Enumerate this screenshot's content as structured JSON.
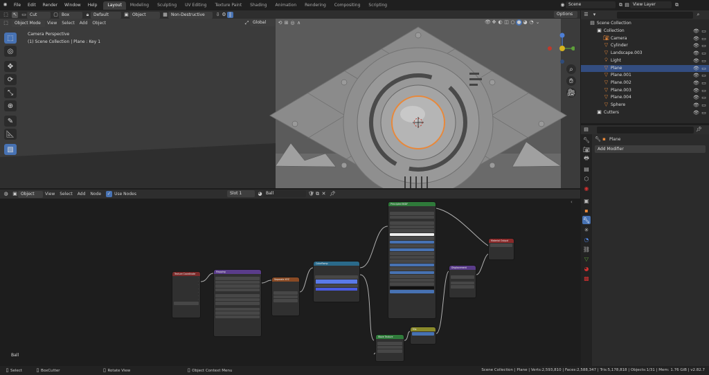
{
  "topbar": {
    "menus": [
      "File",
      "Edit",
      "Render",
      "Window",
      "Help"
    ],
    "workspaces": [
      "Layout",
      "Modeling",
      "Sculpting",
      "UV Editing",
      "Texture Paint",
      "Shading",
      "Animation",
      "Rendering",
      "Compositing",
      "Scripting"
    ],
    "active_workspace": "Layout",
    "scene": "Scene",
    "view_layer": "View Layer"
  },
  "tool_header": {
    "cut": "Cut",
    "box": "Box",
    "default": "Default",
    "object": "Object",
    "mode": "Non-Destructive",
    "options": "Options"
  },
  "viewport_header": {
    "mode": "Object Mode",
    "menus": [
      "View",
      "Select",
      "Add",
      "Object"
    ],
    "transform": "Global"
  },
  "viewport": {
    "perspective": "Camera Perspective",
    "collection_info": "(1) Scene Collection | Plane : Key 1"
  },
  "node_header": {
    "type": "Object",
    "menus": [
      "View",
      "Select",
      "Add",
      "Node"
    ],
    "use_nodes": "Use Nodes",
    "slot": "Slot 1",
    "material": "Ball"
  },
  "node_editor": {
    "material_label": "Ball",
    "nodes": {
      "texcoord": "Texture Coordinate",
      "mapping": "Mapping",
      "separate": "Separate XYZ",
      "ramp": "ColorRamp",
      "bsdf": "Principled BSDF",
      "output": "Material Output",
      "displace": "Displacement",
      "mix": "Mix",
      "wave": "Wave Texture"
    }
  },
  "outliner": {
    "root": "Scene Collection",
    "items": [
      {
        "name": "Collection",
        "indent": 1,
        "icon": "collection-icon",
        "color": "#e0e0e0"
      },
      {
        "name": "Camera",
        "indent": 2,
        "icon": "camera-icon",
        "color": "#e8883a"
      },
      {
        "name": "Cylinder",
        "indent": 2,
        "icon": "mesh-icon",
        "color": "#e8883a"
      },
      {
        "name": "Landscape.003",
        "indent": 2,
        "icon": "mesh-icon",
        "color": "#e8883a"
      },
      {
        "name": "Light",
        "indent": 2,
        "icon": "light-icon",
        "color": "#e8883a"
      },
      {
        "name": "Plane",
        "indent": 2,
        "icon": "mesh-icon",
        "color": "#e8883a",
        "selected": true
      },
      {
        "name": "Plane.001",
        "indent": 2,
        "icon": "mesh-icon",
        "color": "#e8883a"
      },
      {
        "name": "Plane.002",
        "indent": 2,
        "icon": "mesh-icon",
        "color": "#e8883a"
      },
      {
        "name": "Plane.003",
        "indent": 2,
        "icon": "mesh-icon",
        "color": "#e8883a"
      },
      {
        "name": "Plane.004",
        "indent": 2,
        "icon": "mesh-icon",
        "color": "#e8883a"
      },
      {
        "name": "Sphere",
        "indent": 2,
        "icon": "mesh-icon",
        "color": "#e8883a"
      },
      {
        "name": "Cutters",
        "indent": 1,
        "icon": "collection-icon",
        "color": "#e0e0e0"
      }
    ]
  },
  "properties": {
    "object": "Plane",
    "add_modifier": "Add Modifier"
  },
  "status": {
    "select": "Select",
    "boxcutter": "BoxCutter",
    "rotate": "Rotate View",
    "context": "Object Context Menu",
    "stats": "Scene Collection | Plane | Verts:2,593,810 | Faces:2,588,347 | Tris:5,178,818 | Objects:1/31 | Mem: 1.76 GiB | v2.82.7"
  },
  "colors": {
    "accent": "#4772b3",
    "selected_row": "#334d80",
    "object_orange": "#e8883a"
  }
}
